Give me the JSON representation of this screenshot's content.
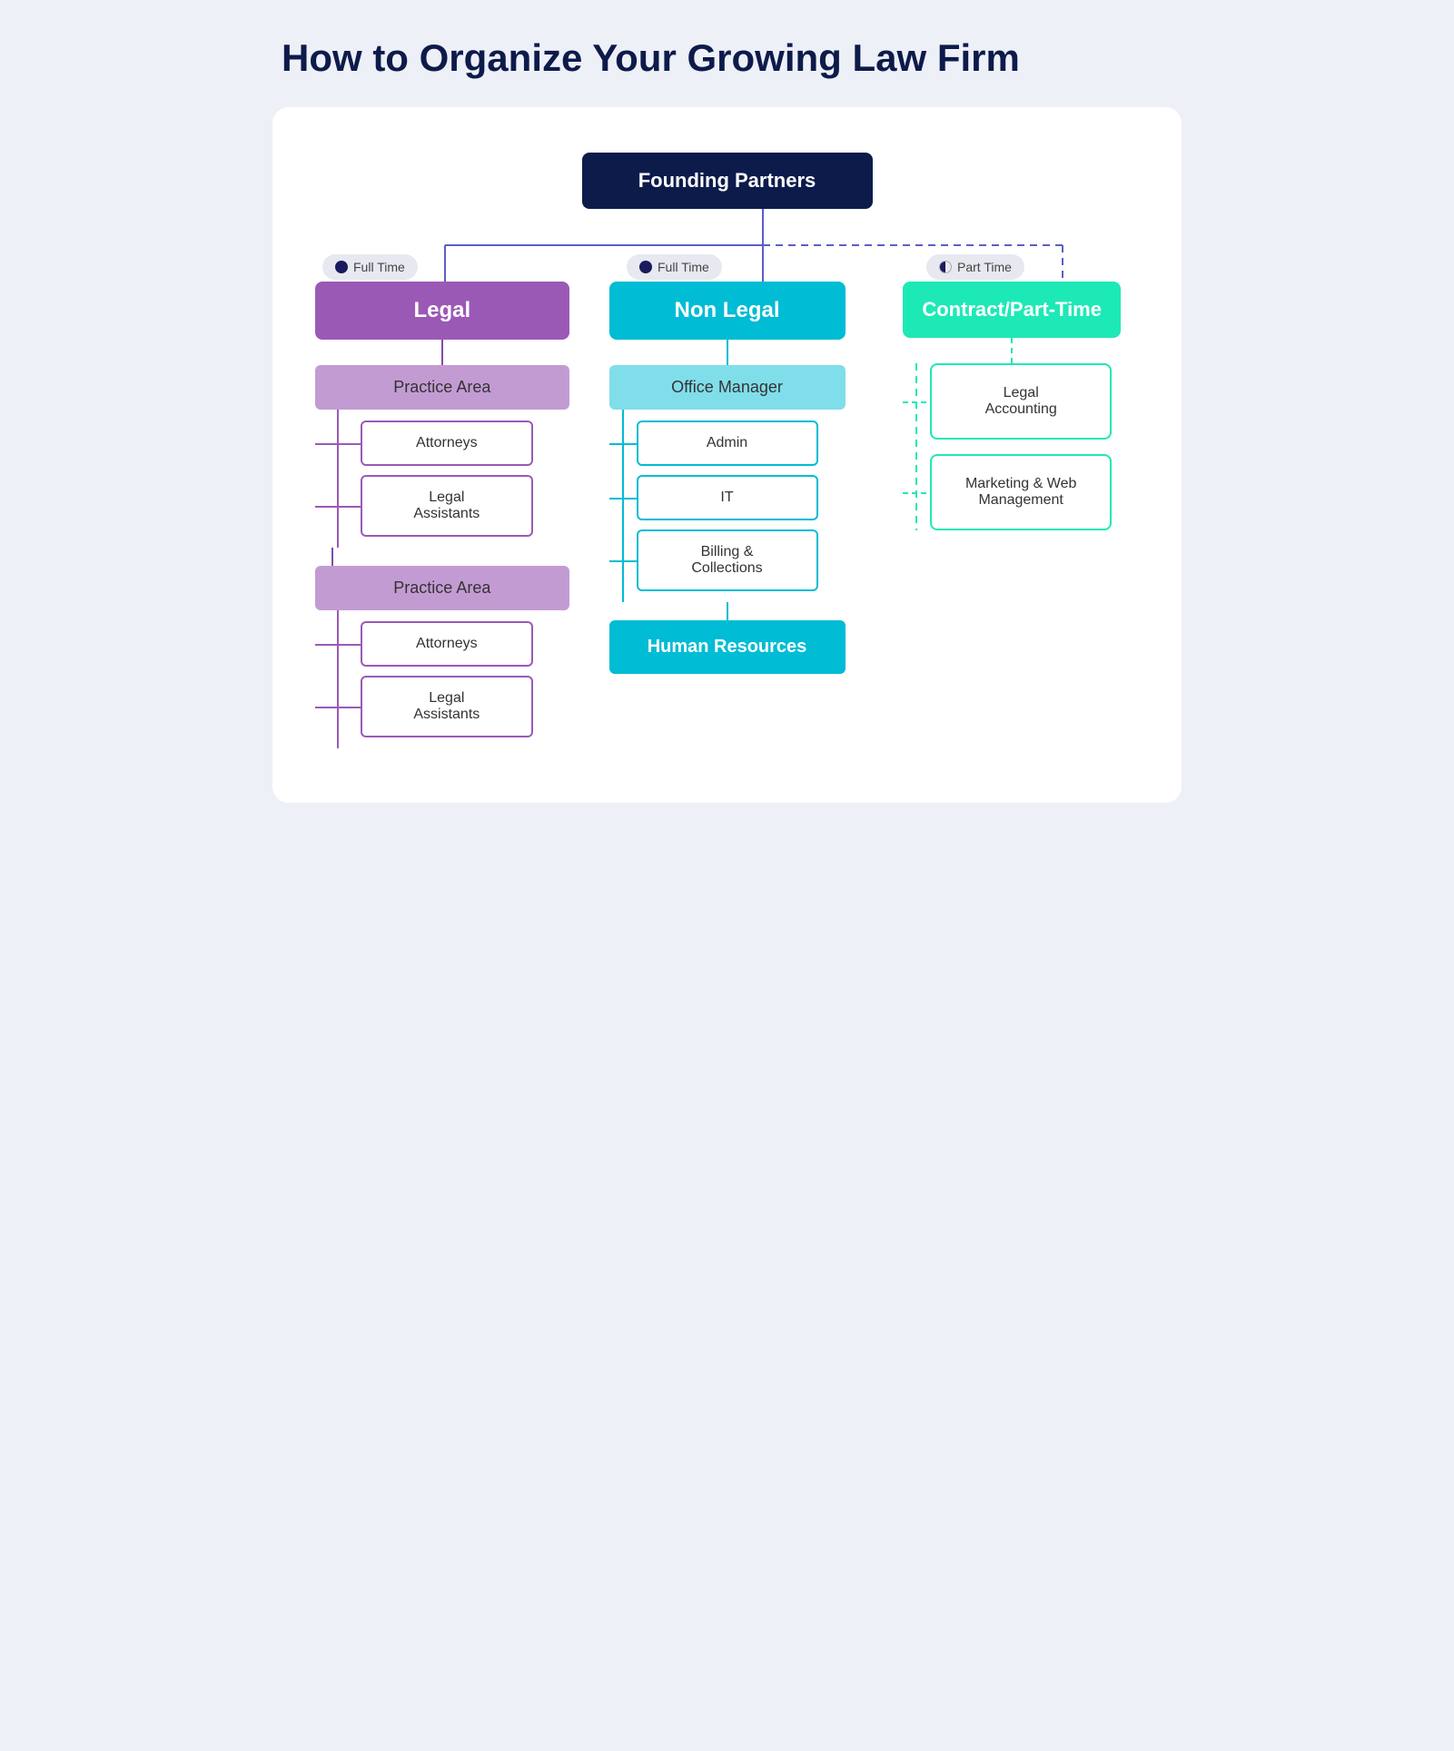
{
  "title": "How to Organize Your Growing Law Firm",
  "chart": {
    "founding_partners": "Founding Partners",
    "columns": {
      "legal": {
        "badge_label": "Full Time",
        "header": "Legal",
        "practice_areas": [
          {
            "label": "Practice Area",
            "children": [
              {
                "label": "Attorneys"
              },
              {
                "label": "Legal\nAssistants"
              }
            ]
          },
          {
            "label": "Practice Area",
            "children": [
              {
                "label": "Attorneys"
              },
              {
                "label": "Legal\nAssistants"
              }
            ]
          }
        ]
      },
      "non_legal": {
        "badge_label": "Full Time",
        "header": "Non Legal",
        "office_manager": "Office Manager",
        "office_manager_children": [
          {
            "label": "Admin"
          },
          {
            "label": "IT"
          },
          {
            "label": "Billing &\nCollections"
          }
        ],
        "hr": "Human Resources"
      },
      "contract": {
        "badge_label": "Part Time",
        "header": "Contract/Part-Time",
        "items": [
          {
            "label": "Legal\nAccounting"
          },
          {
            "label": "Marketing & Web\nManagement"
          }
        ]
      }
    }
  }
}
